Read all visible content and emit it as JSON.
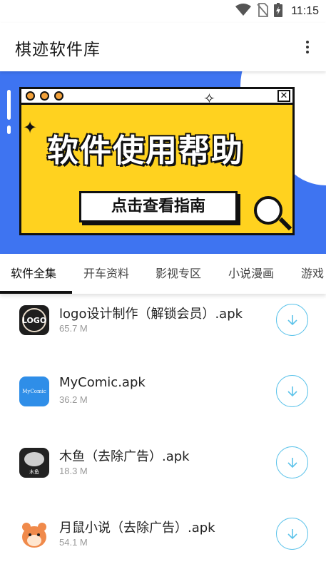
{
  "status_bar": {
    "time": "11:15",
    "icons": [
      "wifi-icon",
      "no-sim-icon",
      "battery-charging-icon"
    ]
  },
  "app_bar": {
    "title": "棋迹软件库",
    "menu_icon": "more-vert-icon"
  },
  "banner": {
    "headline": "软件使用帮助",
    "cta": "点击查看指南",
    "colors": {
      "background": "#3e74f1",
      "card": "#ffd21f"
    }
  },
  "tabs": [
    {
      "label": "软件全集",
      "active": true
    },
    {
      "label": "开车资料",
      "active": false
    },
    {
      "label": "影视专区",
      "active": false
    },
    {
      "label": "小说漫画",
      "active": false
    },
    {
      "label": "游戏",
      "active": false
    }
  ],
  "apps": [
    {
      "name": "logo设计制作（解锁会员）.apk",
      "size": "65.7 M",
      "icon_text": "LOGO"
    },
    {
      "name": "MyComic.apk",
      "size": "36.2 M",
      "icon_text": "MyComic"
    },
    {
      "name": "木鱼（去除广告）.apk",
      "size": "18.3 M",
      "icon_text": "木鱼"
    },
    {
      "name": "月鼠小说（去除广告）.apk",
      "size": "54.1 M",
      "icon_text": ""
    }
  ],
  "colors": {
    "accent": "#5cc3ea",
    "tab_indicator": "#111111"
  }
}
